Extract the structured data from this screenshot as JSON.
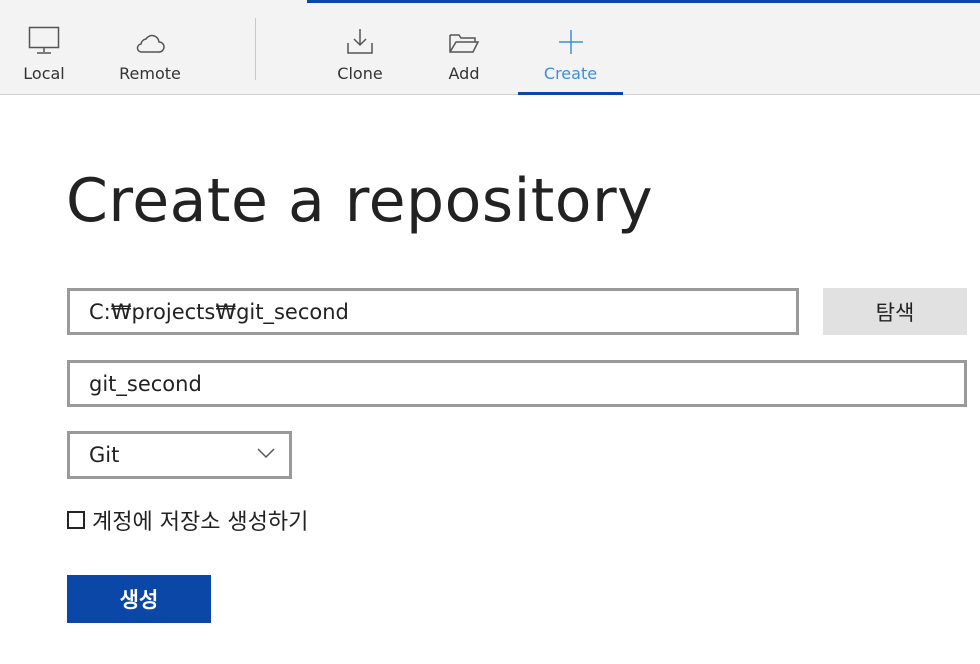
{
  "toolbar": {
    "local_label": "Local",
    "remote_label": "Remote",
    "clone_label": "Clone",
    "add_label": "Add",
    "create_label": "Create",
    "active_tab": "Create",
    "accent_color": "#0b47a6",
    "active_label_color": "#3a8ee6"
  },
  "page": {
    "title": "Create a repository"
  },
  "form": {
    "path_value": "C:₩projects₩git_second",
    "browse_label": "탐색",
    "name_value": "git_second",
    "vcs_selected": "Git",
    "account_checkbox_label": "계정에 저장소 생성하기",
    "account_checkbox_checked": false,
    "create_button_label": "생성"
  },
  "icons": {
    "local": "monitor-icon",
    "remote": "cloud-icon",
    "clone": "download-icon",
    "add": "folder-open-icon",
    "create": "plus-icon",
    "select": "chevron-down-icon"
  }
}
